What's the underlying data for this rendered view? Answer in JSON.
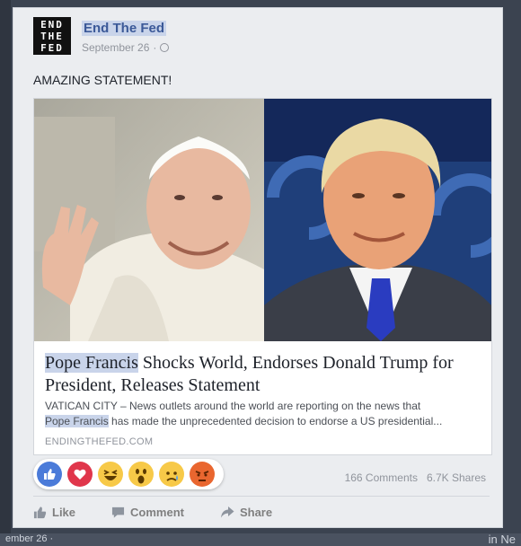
{
  "background": {
    "peek_left_text": "ember 26 ·",
    "peek_right_text": "in Ne"
  },
  "post": {
    "page_name": "End The Fed",
    "avatar_lines": [
      "END",
      "THE",
      "FED"
    ],
    "date": "September 26",
    "meta_separator": "·",
    "privacy_icon": "globe-icon",
    "status_text": "AMAZING STATEMENT!"
  },
  "link_preview": {
    "title_highlight": "Pope Francis",
    "title_rest": " Shocks World, Endorses Donald Trump for President, Releases Statement",
    "desc_line1": "VATICAN CITY – News outlets around the world are reporting on the news that",
    "desc_highlight": "Pope Francis",
    "desc_line2": " has made the unprecedented decision to endorse a US presidential...",
    "domain": "ENDINGTHEFED.COM"
  },
  "reactions": {
    "icons": [
      "like-reaction-icon",
      "love-reaction-icon",
      "haha-reaction-icon",
      "wow-reaction-icon",
      "sad-reaction-icon",
      "angry-reaction-icon"
    ],
    "colors": {
      "like": "#4b7bd9",
      "love": "#e0364b",
      "yellow": "#f7c948",
      "angry": "#e9662f"
    }
  },
  "stats": {
    "comments": "166 Comments",
    "shares": "6.7K Shares"
  },
  "actions": {
    "like": "Like",
    "comment": "Comment",
    "share": "Share"
  },
  "colors": {
    "link_blue": "#3b5998",
    "highlight": "#c9d4ea",
    "text_dark": "#1d2129",
    "text_muted": "#90949c"
  }
}
